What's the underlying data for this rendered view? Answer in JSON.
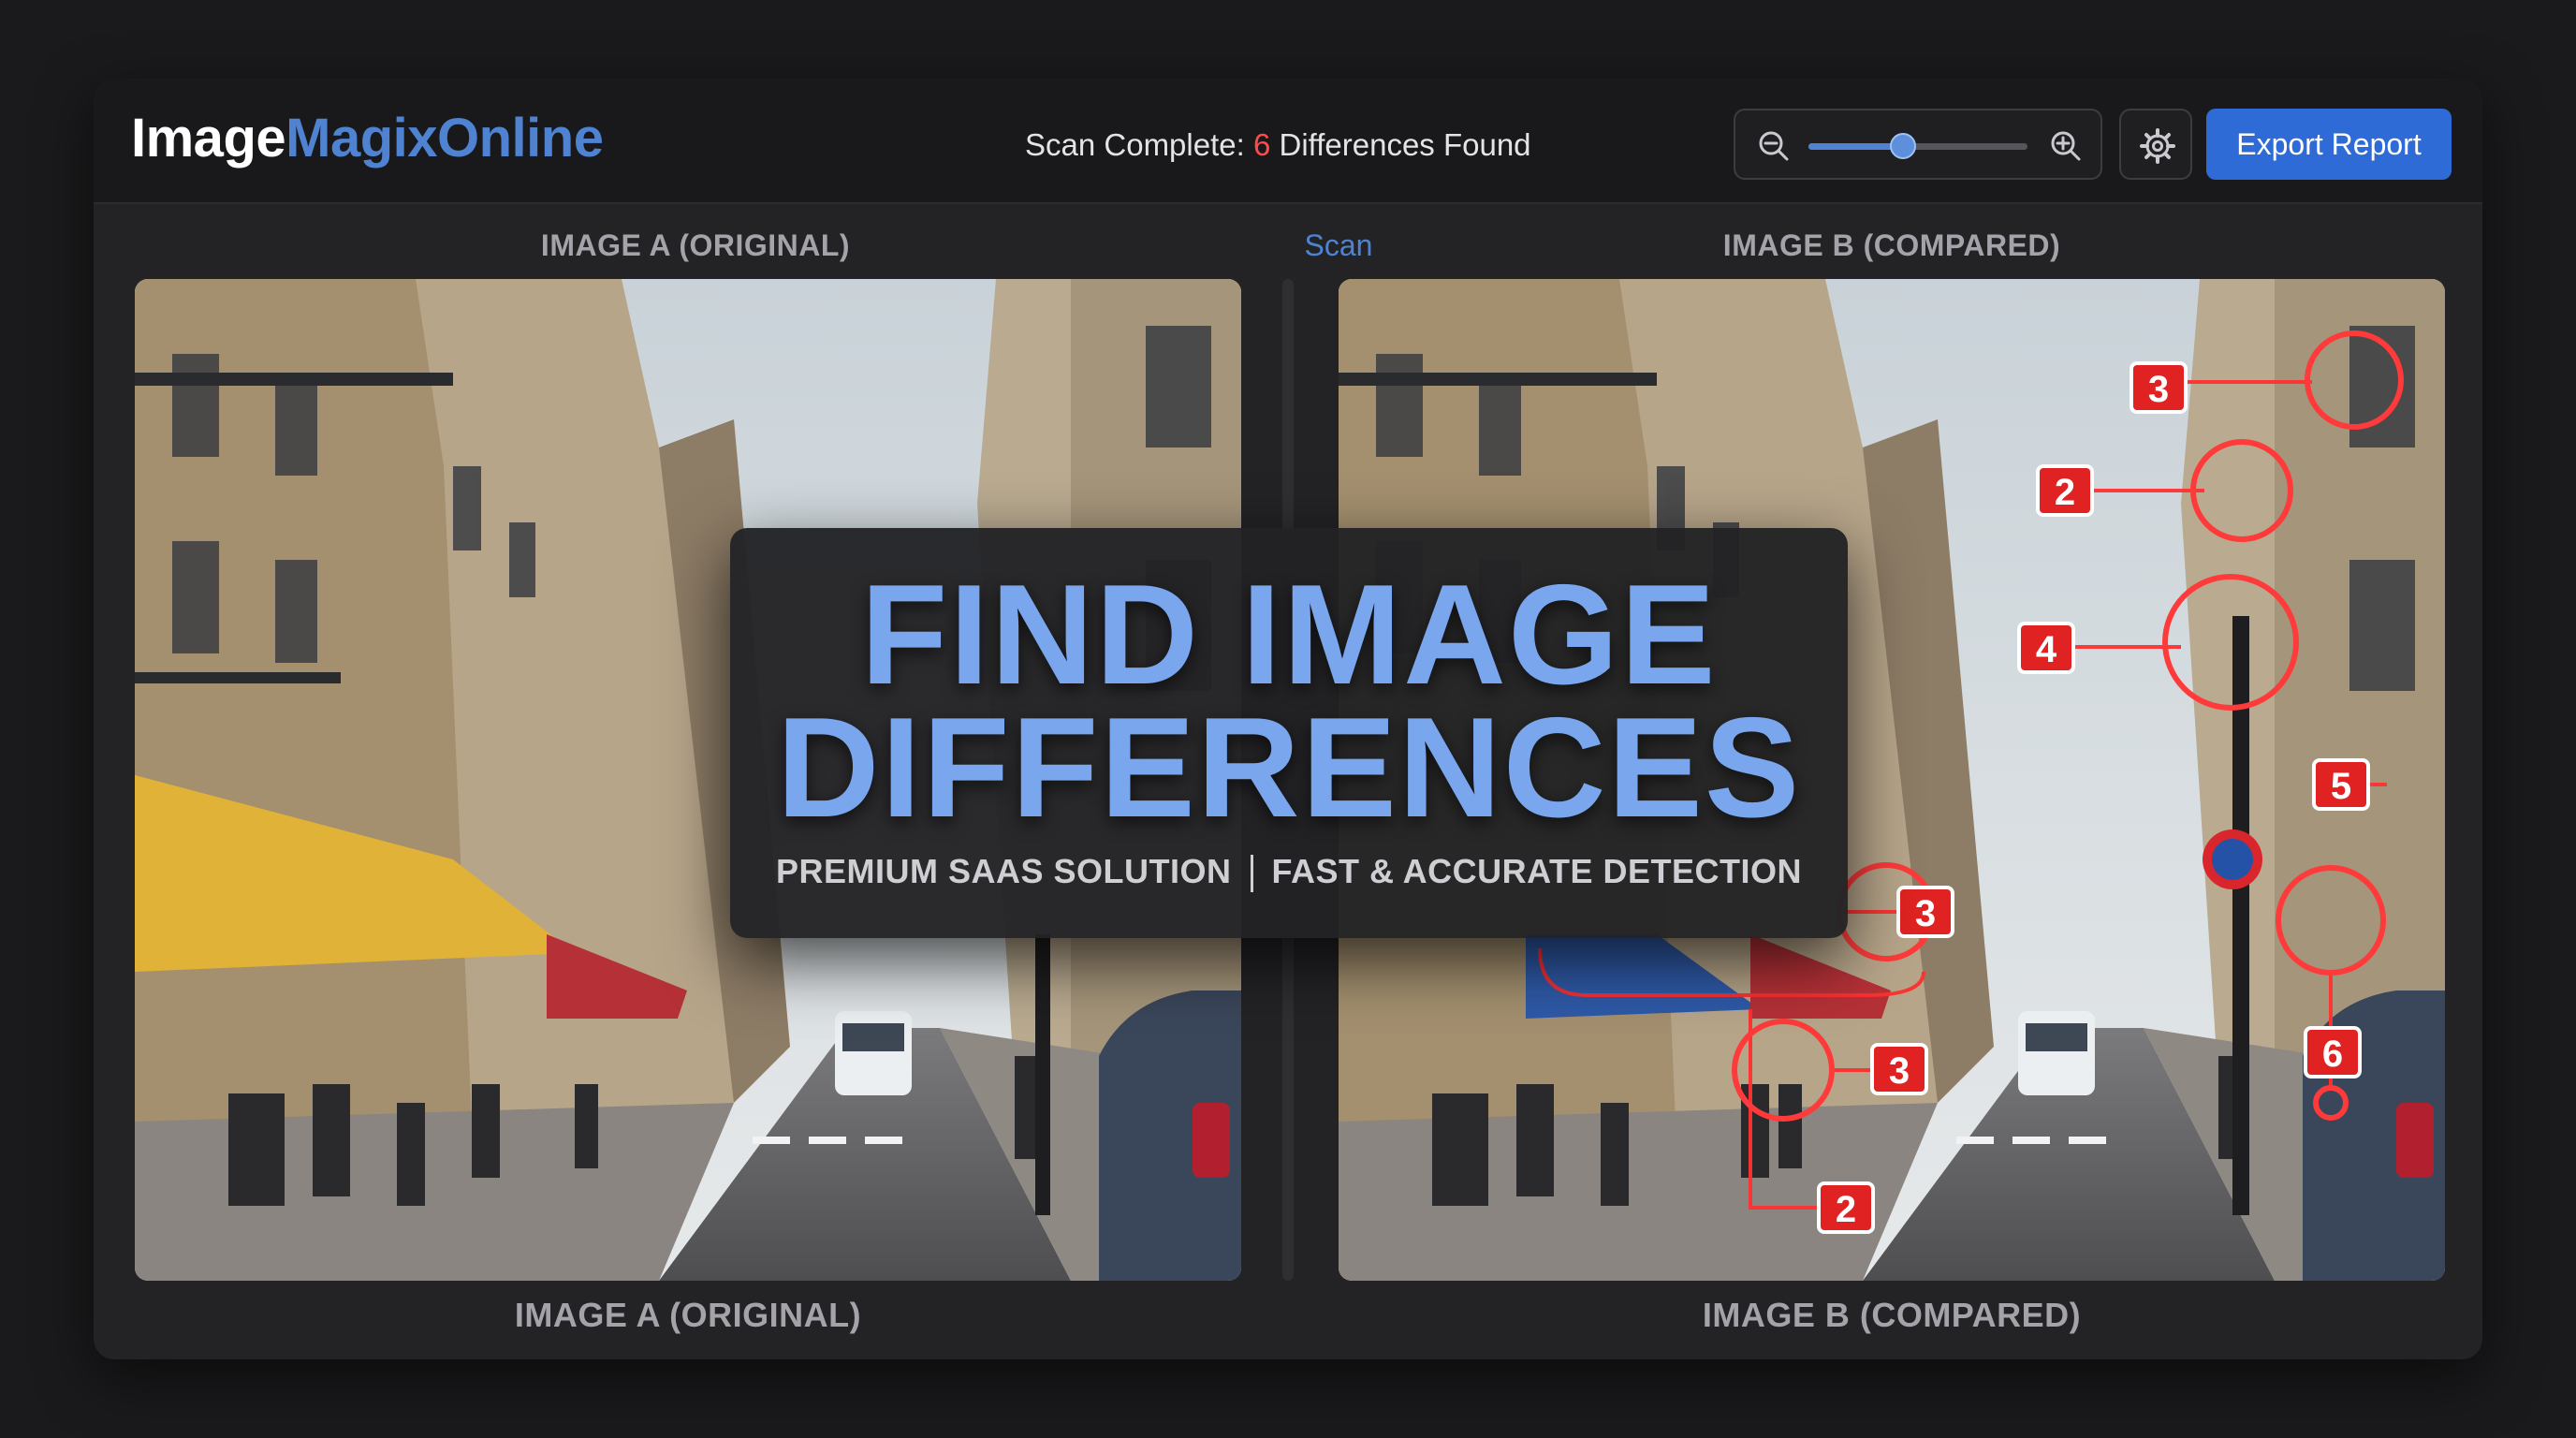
{
  "app": {
    "logo_part1": "Image",
    "logo_part2": "MagixOnline"
  },
  "header": {
    "scan_prefix": "Scan Complete: ",
    "difference_count": "6",
    "scan_suffix": " Differences Found",
    "zoom_level": 0.43,
    "export_label": "Export Report"
  },
  "labels": {
    "top_left": "IMAGE A (ORIGINAL)",
    "top_center": "Scan",
    "top_right": "IMAGE B (COMPARED)",
    "bottom_left": "IMAGE A (ORIGINAL)",
    "bottom_right": "IMAGE B (COMPARED)"
  },
  "hero": {
    "line1": "FIND IMAGE",
    "line2": "DIFFERENCES",
    "sub_left": "PREMIUM SAAS SOLUTION",
    "sub_right": "FAST & ACCURATE DETECTION"
  },
  "markers": [
    "3",
    "2",
    "4",
    "5",
    "3",
    "3",
    "6",
    "2"
  ],
  "colors": {
    "accent": "#4f83d1",
    "primary_button": "#2f6bd6",
    "difference_marker": "#e52424",
    "count_highlight": "#ff4b4b"
  },
  "icons": [
    "zoom-out-icon",
    "zoom-in-icon",
    "gear-icon"
  ]
}
